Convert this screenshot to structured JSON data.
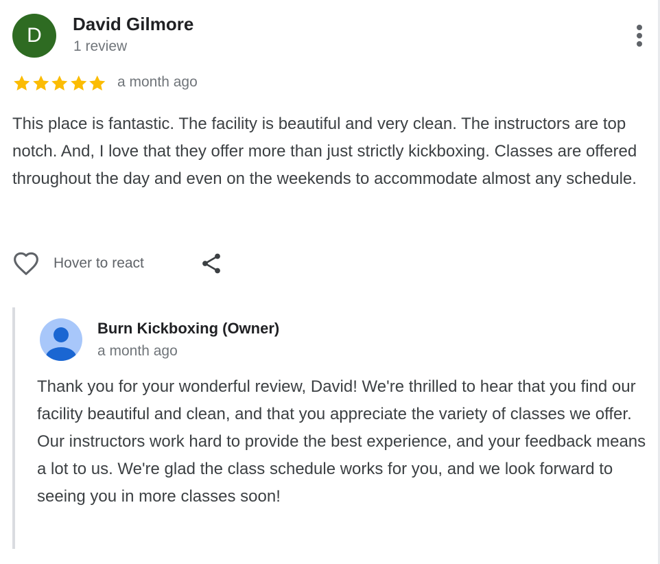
{
  "review": {
    "avatar_initial": "D",
    "avatar_color": "#2e6b22",
    "reviewer_name": "David Gilmore",
    "review_count": "1 review",
    "rating": 5,
    "rating_max": 5,
    "star_color": "#fbbc04",
    "date": "a month ago",
    "text": "This place is fantastic. The facility is beautiful and very clean. The instructors are top notch. And, I love that they offer more than just strictly kickboxing. Classes are offered throughout the day and even on the weekends to accommodate almost any schedule.",
    "more_icon": "more-vert-icon"
  },
  "actions": {
    "react_icon": "heart-outline-icon",
    "react_label": "Hover to react",
    "share_icon": "share-icon"
  },
  "owner_reply": {
    "avatar_icon": "person-icon",
    "name": "Burn Kickboxing (Owner)",
    "date": "a month ago",
    "text": "Thank you for your wonderful review, David! We're thrilled to hear that you find our facility beautiful and clean, and that you appreciate the variety of classes we offer. Our instructors work hard to provide the best experience, and your feedback means a lot to us. We're glad the class schedule works for you, and we look forward to seeing you in more classes soon!"
  }
}
